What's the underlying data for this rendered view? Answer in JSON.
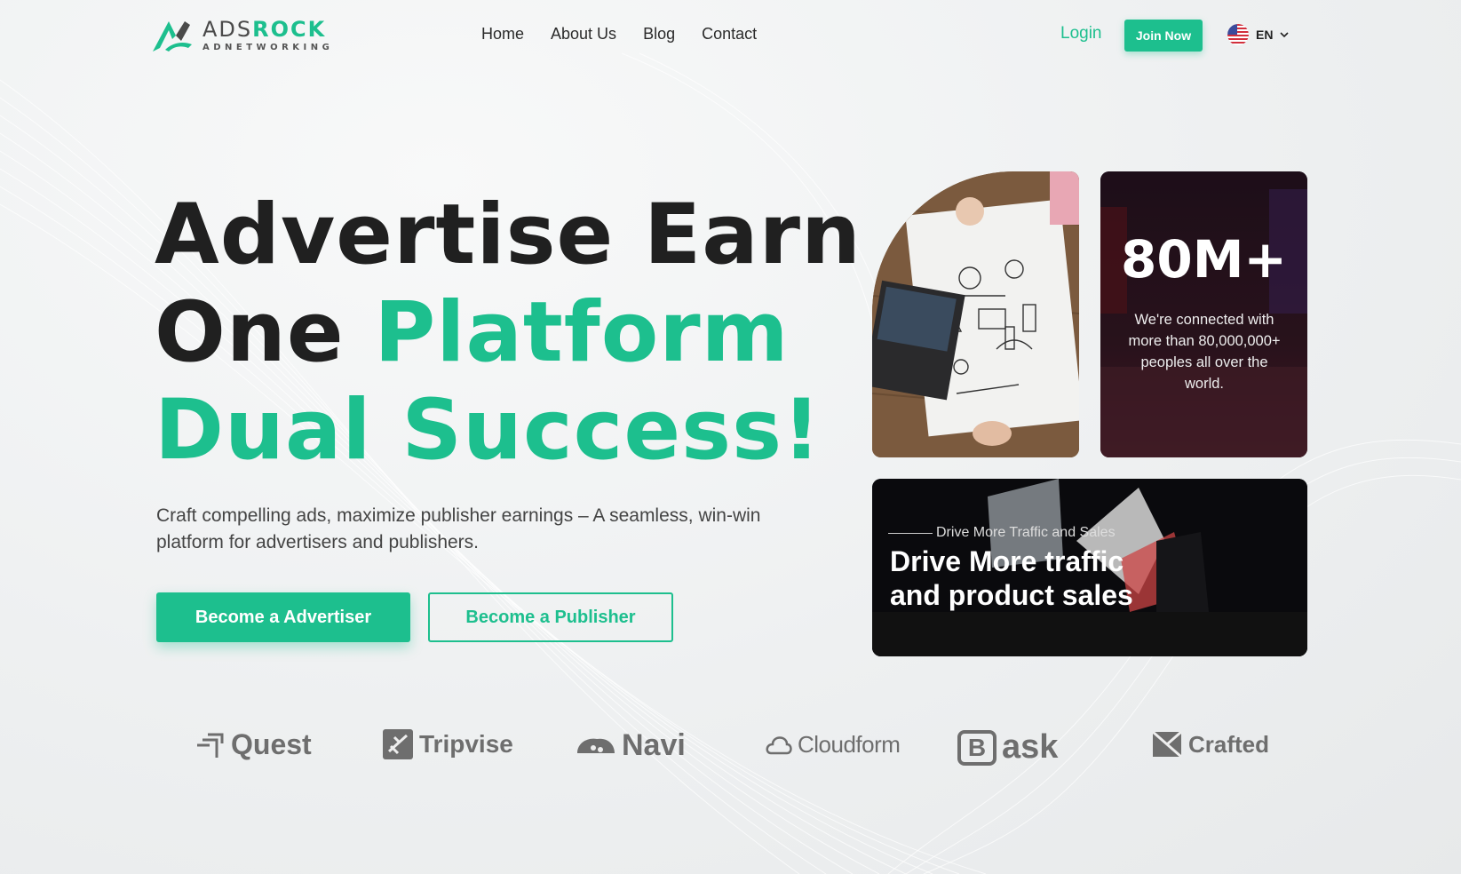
{
  "brand": {
    "word_a": "ADS",
    "word_b": "ROCK",
    "tagline": "ADNETWORKING"
  },
  "nav": {
    "items": [
      "Home",
      "About Us",
      "Blog",
      "Contact"
    ]
  },
  "header": {
    "login": "Login",
    "join": "Join Now",
    "lang": "EN"
  },
  "hero": {
    "line1": "Advertise Earn",
    "line2_dark": "One",
    "line2_green": "Platform",
    "line3": "Dual Success!",
    "subtext": "Craft compelling ads, maximize publisher earnings – A seamless, win-win platform for advertisers and publishers.",
    "btn_advertiser": "Become a Advertiser",
    "btn_publisher": "Become a Publisher"
  },
  "stat_card": {
    "number": "80M+",
    "text": "We're connected with more than 80,000,000+ peoples all over the world."
  },
  "promo_card": {
    "eyebrow": "Drive More Traffic and Sales",
    "title": "Drive More traffic and product sales"
  },
  "partners": [
    "Quest",
    "Tripvise",
    "Navi",
    "Cloudform",
    "ask",
    "Crafted"
  ],
  "partner_badge": "B",
  "colors": {
    "accent": "#1dbf8e",
    "dark": "#202020"
  }
}
